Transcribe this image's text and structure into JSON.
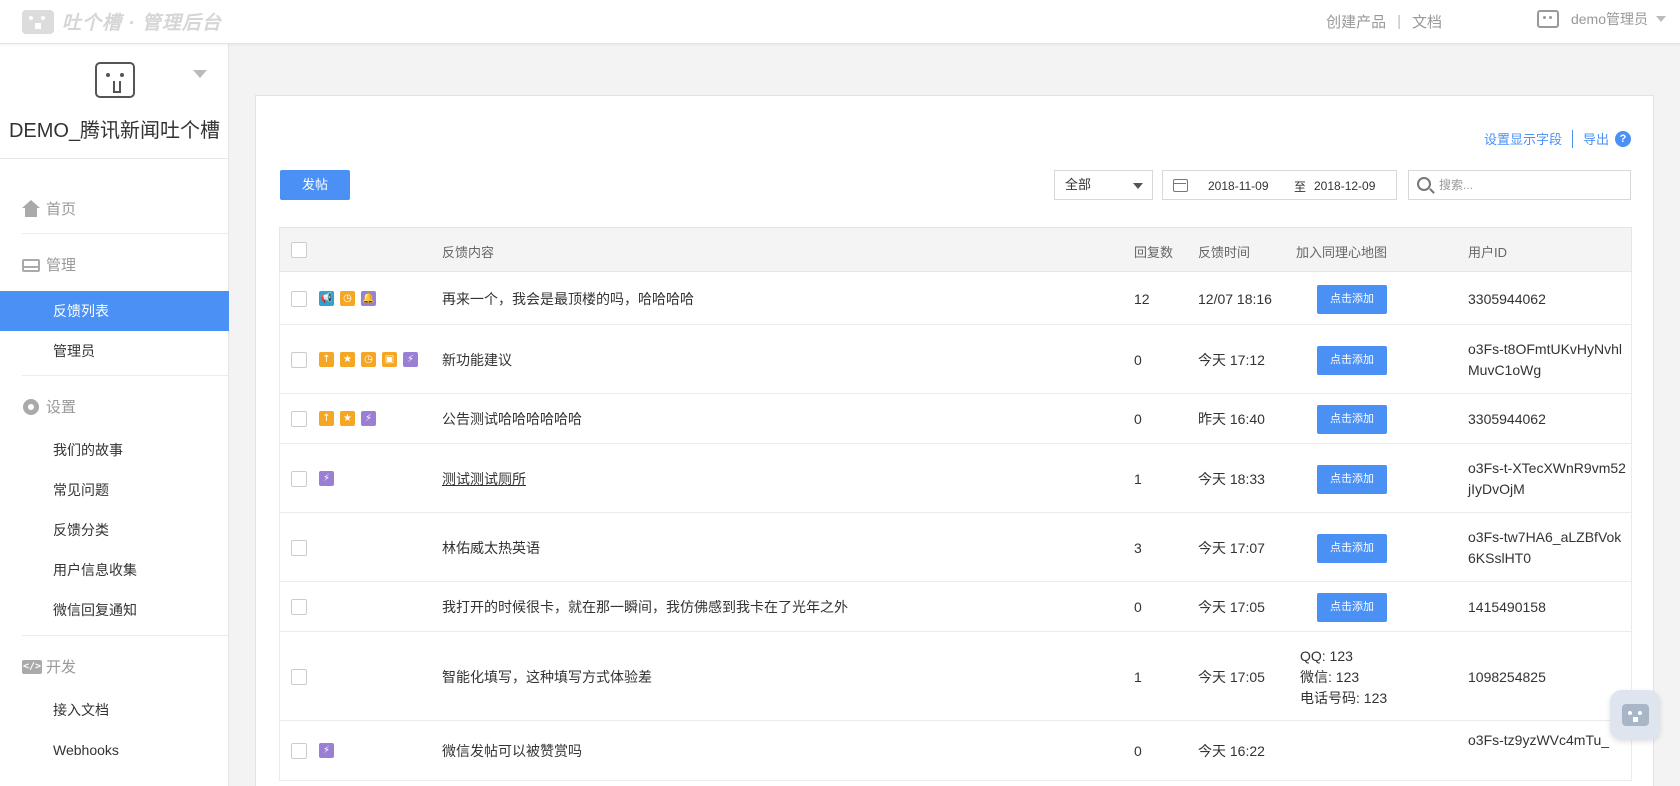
{
  "topbar": {
    "brand": "吐个槽 · 管理后台",
    "links": [
      "创建产品",
      "文档"
    ],
    "user": "demo管理员"
  },
  "sidebar": {
    "product_name": "DEMO_腾讯新闻吐个槽",
    "sections": [
      {
        "label": "首页",
        "icon": "home-icon"
      },
      {
        "label": "管理",
        "icon": "inbox-icon"
      },
      {
        "label": "设置",
        "icon": "gear-icon"
      },
      {
        "label": "开发",
        "icon": "code-icon"
      }
    ],
    "items": [
      {
        "label": "反馈列表",
        "active": true
      },
      {
        "label": "管理员"
      },
      {
        "label": "我们的故事"
      },
      {
        "label": "常见问题"
      },
      {
        "label": "反馈分类"
      },
      {
        "label": "用户信息收集"
      },
      {
        "label": "微信回复通知"
      },
      {
        "label": "接入文档"
      },
      {
        "label": "Webhooks"
      }
    ]
  },
  "toolbar": {
    "set_fields": "设置显示字段",
    "export": "导出",
    "help": "?",
    "post_button": "发帖",
    "filter_selected": "全部",
    "date_from": "2018-11-09",
    "date_to_label": "至",
    "date_to": "2018-12-09",
    "search_placeholder": "搜索..."
  },
  "table": {
    "headers": {
      "content": "反馈内容",
      "replies": "回复数",
      "time": "反馈时间",
      "map": "加入同理心地图",
      "uid": "用户ID"
    },
    "add_label": "点击添加",
    "rows": [
      {
        "tags": [
          "teal",
          "orange",
          "purple"
        ],
        "tag_glyphs": [
          "📢",
          "◷",
          "🔔"
        ],
        "content": "再来一个，我会是最顶楼的吗，哈哈哈哈",
        "replies": "12",
        "time": "12/07 18:16",
        "uid": "3305944062"
      },
      {
        "tags": [
          "orange",
          "orange",
          "orange",
          "orange",
          "purple"
        ],
        "tag_glyphs": [
          "↑",
          "★",
          "◷",
          "▣",
          "⚡"
        ],
        "content": "新功能建议",
        "replies": "0",
        "time": "今天 17:12",
        "uid": "o3Fs-t8OFmtUKvHyNvhlMuvC1oWg"
      },
      {
        "tags": [
          "orange",
          "orange",
          "purple"
        ],
        "tag_glyphs": [
          "↑",
          "★",
          "⚡"
        ],
        "content": "公告测试哈哈哈哈哈哈",
        "replies": "0",
        "time": "昨天 16:40",
        "uid": "3305944062"
      },
      {
        "tags": [
          "purple"
        ],
        "tag_glyphs": [
          "⚡"
        ],
        "content": "测试测试厕所",
        "replies": "1",
        "time": "今天 18:33",
        "uid": "o3Fs-t-XTecXWnR9vm52jIyDvOjM"
      },
      {
        "tags": [],
        "tag_glyphs": [],
        "content": "林佑威太热英语",
        "replies": "3",
        "time": "今天 17:07",
        "uid": "o3Fs-tw7HA6_aLZBfVok6KSslHT0"
      },
      {
        "tags": [],
        "tag_glyphs": [],
        "content": "我打开的时候很卡，就在那一瞬间，我仿佛感到我卡在了光年之外",
        "replies": "0",
        "time": "今天 17:05",
        "uid": "1415490158"
      },
      {
        "tags": [],
        "tag_glyphs": [],
        "content": "智能化填写，这种填写方式体验差",
        "replies": "1",
        "time": "今天 17:05",
        "contact": [
          "QQ: 123",
          "微信: 123",
          "电话号码: 123"
        ],
        "uid": "1098254825"
      },
      {
        "tags": [
          "purple"
        ],
        "tag_glyphs": [
          "⚡"
        ],
        "content": "微信发帖可以被赞赏吗",
        "replies": "0",
        "time": "今天 16:22",
        "uid": "o3Fs-tz9yzWVc4mTu_"
      }
    ]
  },
  "colors": {
    "accent": "#4a90f5",
    "tag_teal": "#2aa5d6",
    "tag_orange": "#f5a623",
    "tag_purple": "#9b7fd4"
  }
}
